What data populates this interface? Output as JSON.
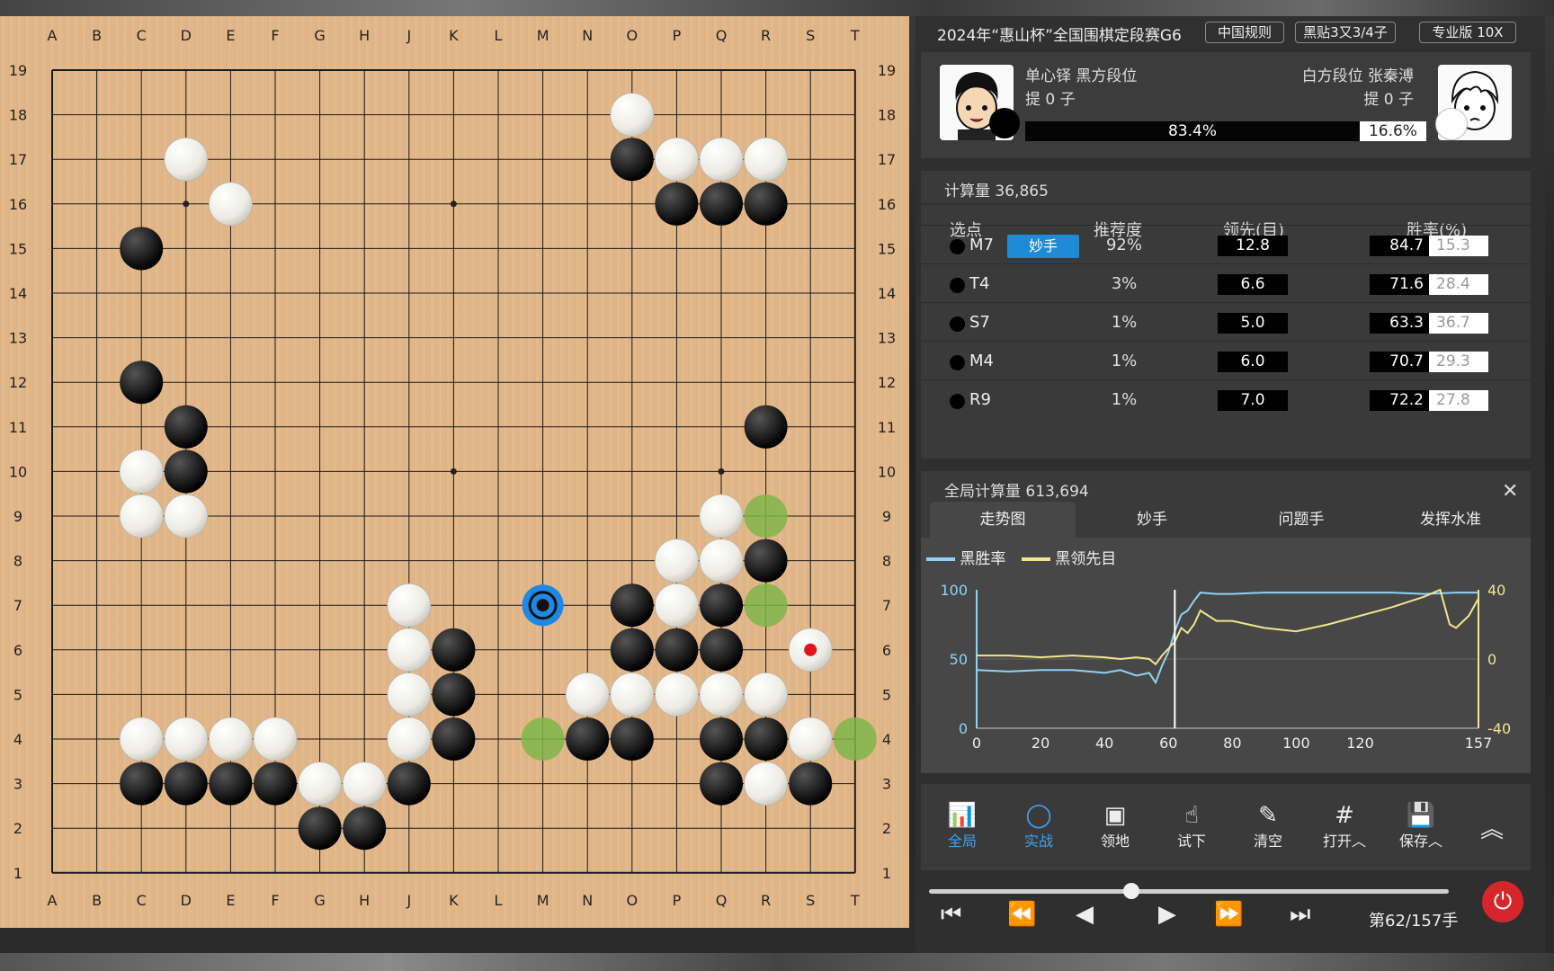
{
  "board": {
    "cols": [
      "A",
      "B",
      "C",
      "D",
      "E",
      "F",
      "G",
      "H",
      "J",
      "K",
      "L",
      "M",
      "N",
      "O",
      "P",
      "Q",
      "R",
      "S",
      "T"
    ],
    "rows": [
      "19",
      "18",
      "17",
      "16",
      "15",
      "14",
      "13",
      "12",
      "11",
      "10",
      "9",
      "8",
      "7",
      "6",
      "5",
      "4",
      "3",
      "2",
      "1"
    ],
    "black_stones": [
      "O17",
      "P16",
      "Q16",
      "R16",
      "C15",
      "C12",
      "D11",
      "D10",
      "R11",
      "R8",
      "O7",
      "Q7",
      "K6",
      "O6",
      "P6",
      "Q6",
      "K5",
      "K4",
      "N4",
      "O4",
      "Q4",
      "R4",
      "C3",
      "D3",
      "E3",
      "F3",
      "J3",
      "Q3",
      "S3",
      "G2",
      "H2"
    ],
    "white_stones": [
      "O18",
      "D17",
      "P17",
      "Q17",
      "R17",
      "E16",
      "C10",
      "C9",
      "D9",
      "Q9",
      "P8",
      "Q8",
      "J7",
      "P7",
      "J6",
      "J5",
      "N5",
      "O5",
      "P5",
      "Q5",
      "R5",
      "C4",
      "D4",
      "E4",
      "F4",
      "J4",
      "S4",
      "G3",
      "H3",
      "R3",
      "S6"
    ],
    "green_marks": [
      "R9",
      "R7",
      "M4",
      "T4"
    ],
    "suggested_move": "M7",
    "last_move": "S6",
    "star_points": [
      "D16",
      "K16",
      "Q16",
      "D10",
      "K10",
      "Q10",
      "D4",
      "K4",
      "Q4"
    ],
    "colors": {
      "wood": "#e3b88a",
      "line": "#1a1a1a",
      "green": "#7fb649",
      "blue": "#1e88e5",
      "red": "#e01515"
    }
  },
  "header": {
    "title": "2024年“惠山杯”全国围棋定段赛G6",
    "tags": [
      "中国规则",
      "黑贴3又3/4子",
      "专业版 10X"
    ]
  },
  "players": {
    "black_name": "单心铎 黑方段位",
    "black_captures": "提 0 子",
    "white_name": "白方段位 张秦溥",
    "white_captures": "提 0 子",
    "black_winrate": "83.4%",
    "white_winrate": "16.6%",
    "black_winrate_value": 83.4
  },
  "analysis": {
    "calc_label": "计算量 36,865",
    "headers": [
      "选点",
      "推荐度",
      "领先(目)",
      "胜率(%)"
    ],
    "rows": [
      {
        "move": "M7",
        "badge": "妙手",
        "pct": "92%",
        "lead": "12.8",
        "wb": "84.7",
        "ww": "15.3"
      },
      {
        "move": "T4",
        "badge": "",
        "pct": "3%",
        "lead": "6.6",
        "wb": "71.6",
        "ww": "28.4"
      },
      {
        "move": "S7",
        "badge": "",
        "pct": "1%",
        "lead": "5.0",
        "wb": "63.3",
        "ww": "36.7"
      },
      {
        "move": "M4",
        "badge": "",
        "pct": "1%",
        "lead": "6.0",
        "wb": "70.7",
        "ww": "29.3"
      },
      {
        "move": "R9",
        "badge": "",
        "pct": "1%",
        "lead": "7.0",
        "wb": "72.2",
        "ww": "27.8"
      }
    ]
  },
  "global": {
    "calc_label": "全局计算量 613,694",
    "tabs": [
      "走势图",
      "妙手",
      "问题手",
      "发挥水准"
    ],
    "legend_winrate": "黑胜率",
    "legend_lead": "黑领先目"
  },
  "chart_data": {
    "type": "line",
    "x_ticks": [
      "0",
      "20",
      "40",
      "60",
      "80",
      "100",
      "120",
      "157"
    ],
    "y_left_ticks": [
      "100",
      "50",
      "0"
    ],
    "y_right_ticks": [
      "40",
      "0",
      "-40"
    ],
    "xlim": [
      0,
      157
    ],
    "ylim_left": [
      0,
      100
    ],
    "ylim_right": [
      -40,
      40
    ],
    "current_move": 62,
    "series": [
      {
        "name": "黑胜率",
        "color": "#8fd3f4",
        "axis": "left",
        "x": [
          0,
          10,
          20,
          30,
          40,
          45,
          50,
          54,
          56,
          58,
          60,
          62,
          64,
          66,
          68,
          70,
          75,
          80,
          90,
          100,
          110,
          120,
          130,
          140,
          150,
          157
        ],
        "y": [
          42,
          41,
          42,
          42,
          40,
          42,
          38,
          40,
          33,
          45,
          55,
          70,
          82,
          85,
          92,
          98,
          97,
          97,
          98,
          98,
          98,
          98,
          98,
          97,
          98,
          98
        ]
      },
      {
        "name": "黑领先目",
        "color": "#f0e68c",
        "axis": "right",
        "x": [
          0,
          10,
          20,
          30,
          40,
          45,
          50,
          54,
          56,
          58,
          60,
          62,
          64,
          66,
          68,
          70,
          75,
          80,
          90,
          100,
          110,
          120,
          130,
          140,
          145,
          148,
          150,
          154,
          157
        ],
        "y": [
          2,
          2,
          1,
          2,
          1,
          0,
          1,
          0,
          -3,
          2,
          6,
          10,
          18,
          15,
          20,
          28,
          22,
          22,
          18,
          16,
          20,
          25,
          30,
          36,
          40,
          20,
          18,
          25,
          35
        ]
      }
    ]
  },
  "toolbar": {
    "items": [
      {
        "icon": "📊",
        "label": "全局",
        "active": true
      },
      {
        "icon": "◯",
        "label": "实战",
        "active": true
      },
      {
        "icon": "▣",
        "label": "领地",
        "active": false
      },
      {
        "icon": "☝",
        "label": "试下",
        "active": false
      },
      {
        "icon": "✎",
        "label": "清空",
        "active": false
      },
      {
        "icon": "#",
        "label": "打开︿",
        "active": false
      },
      {
        "icon": "💾",
        "label": "保存︿",
        "active": false
      }
    ],
    "collapse": "︽"
  },
  "playback": {
    "move_label": "第62/157手",
    "progress": 0.39
  }
}
